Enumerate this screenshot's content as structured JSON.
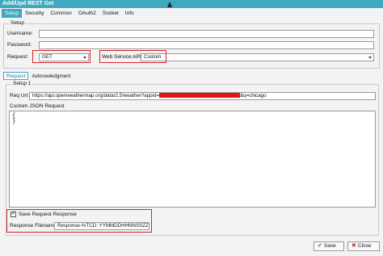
{
  "window": {
    "title": "Add/Upd REST Get"
  },
  "top_tabs": [
    "Setup",
    "Security",
    "Common",
    "OAuth2",
    "Socket",
    "Info"
  ],
  "setup": {
    "group_title": "Setup",
    "username_label": "Username:",
    "username_value": "",
    "password_label": "Password:",
    "password_value": "",
    "request_label": "Request:",
    "request_value": "GET",
    "webservice_label": "Web Service API:",
    "webservice_value": "Custom"
  },
  "mid_tabs": [
    "Request",
    "Acknowledgment"
  ],
  "setup1": {
    "group_title": "Setup 1",
    "req_url_label": "Req Url:",
    "req_url_prefix": "https://api.openweathermap.org/data/2.5/weather?appid=",
    "req_url_suffix": "&q=chicago",
    "custom_json_label": "Custom JSON Request",
    "custom_json_value": "{\n}",
    "save_response_label": "Save Request Response",
    "save_response_checked": true,
    "response_filename_label": "Response Filename:",
    "response_filename_value": "Response-%TCD::YYMMDDHHNNSSZZZ:.json"
  },
  "buttons": {
    "save_label": "Save",
    "close_label": "Close"
  },
  "colors": {
    "accent": "#3fa9c0",
    "highlight_box": "#d9232a"
  },
  "icons": {
    "save": "check-icon",
    "close": "x-icon",
    "cursor": "mouse-pointer-icon"
  }
}
